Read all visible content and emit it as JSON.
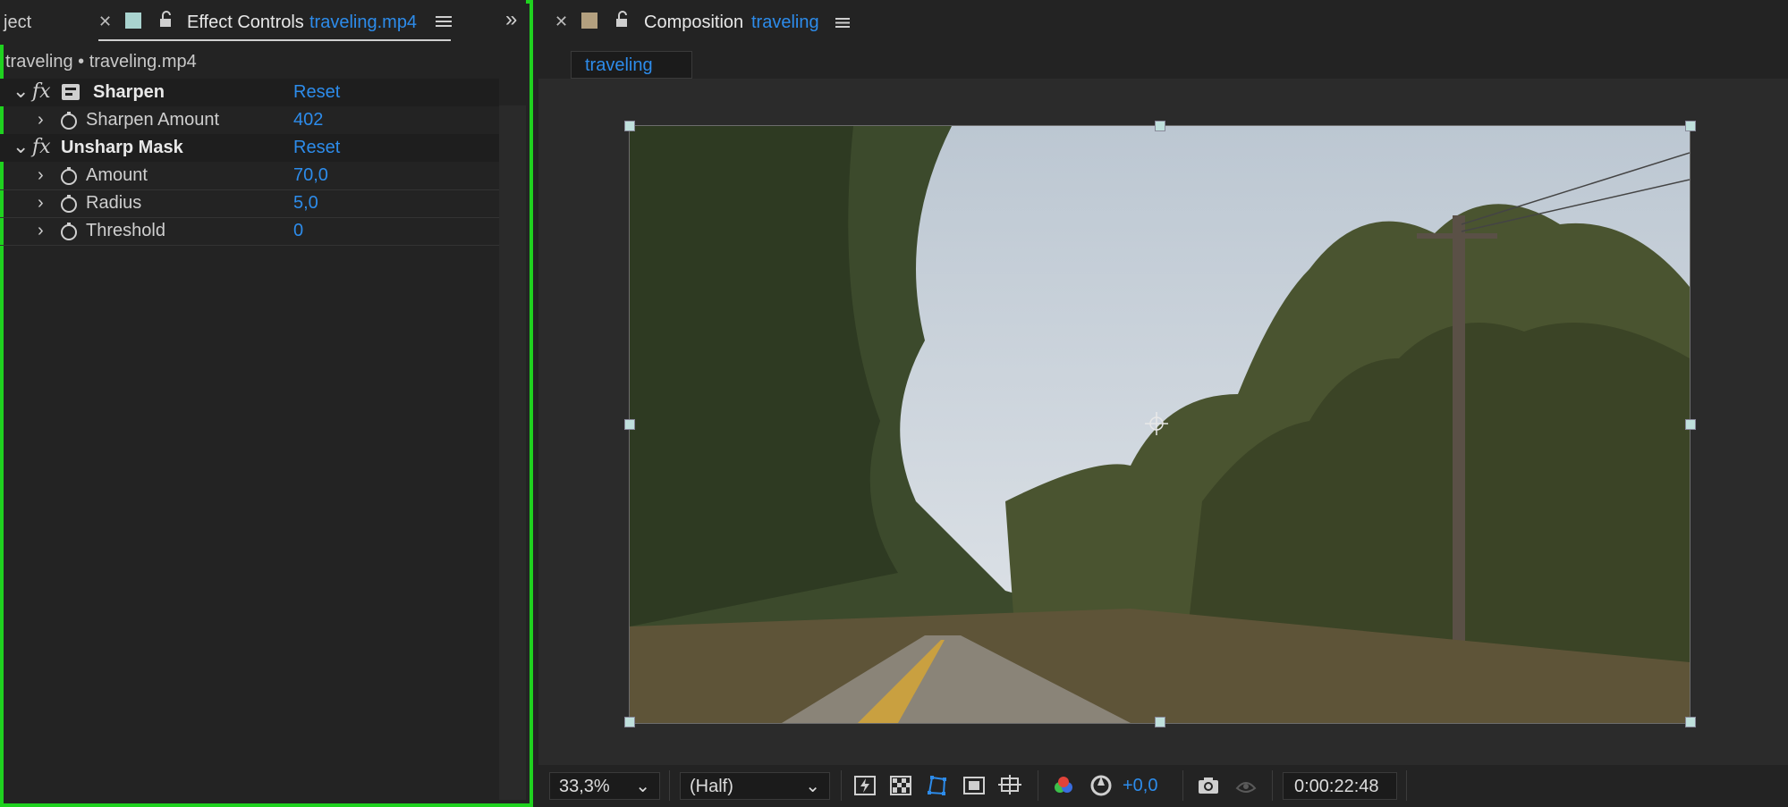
{
  "left_panel": {
    "tab_partial": "ject",
    "tab_title": "Effect Controls",
    "tab_file": "traveling.mp4",
    "subtitle": "traveling • traveling.mp4",
    "effects": [
      {
        "name": "Sharpen",
        "reset": "Reset",
        "params": [
          {
            "label": "Sharpen Amount",
            "value": "402"
          }
        ]
      },
      {
        "name": "Unsharp Mask",
        "reset": "Reset",
        "params": [
          {
            "label": "Amount",
            "value": "70,0"
          },
          {
            "label": "Radius",
            "value": "5,0"
          },
          {
            "label": "Threshold",
            "value": "0"
          }
        ]
      }
    ]
  },
  "composition": {
    "panel_title": "Composition",
    "comp_name": "traveling",
    "tab_label": "traveling"
  },
  "viewer_toolbar": {
    "zoom": "33,3%",
    "resolution": "(Half)",
    "exposure": "+0,0",
    "timecode": "0:00:22:48"
  },
  "icons": [
    "close-icon",
    "label-color-swatch",
    "lock-icon",
    "panel-menu-icon",
    "overflow-chevrons-icon",
    "fx-icon",
    "stopwatch-icon",
    "expand-arrow-icon",
    "fast-preview-icon",
    "transparency-grid-icon",
    "mask-path-icon",
    "region-of-interest-icon",
    "guides-icon",
    "color-channels-icon",
    "reset-exposure-icon",
    "snapshot-icon",
    "show-snapshot-icon"
  ],
  "colors": {
    "accent_blue": "#2d8ceb",
    "highlight_green": "#1fd21f",
    "panel_bg": "#232323"
  }
}
